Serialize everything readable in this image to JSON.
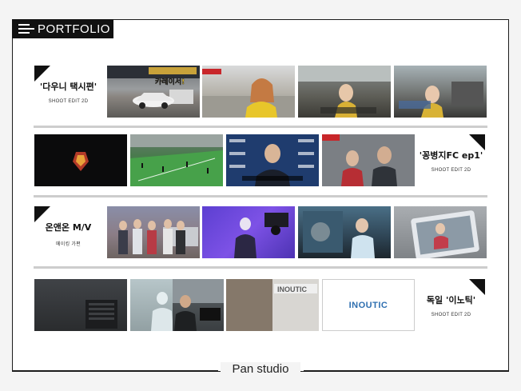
{
  "header": {
    "title": "PORTFOLIO"
  },
  "rows": [
    {
      "title": "'다우니 택시편'",
      "subtitle": "SHOOT EDIT 2D"
    },
    {
      "title": "'꽁병지FC ep1'",
      "subtitle": "SHOOT EDIT 2D"
    },
    {
      "title": "온앤온 M/V",
      "subtitle": "메이킹 가편"
    },
    {
      "title": "독일 '이노틱'",
      "subtitle": "SHOOT EDIT 2D"
    }
  ],
  "thumbnails": {
    "t1_caption": "카레이서!",
    "t9_logo": "INOUTIC",
    "t15_text": "INOUTIC"
  },
  "footer": {
    "brand": "Pan studio"
  },
  "colors": {
    "frame": "#1b1b1b",
    "tab": "#111111",
    "divider": "#cdcdcd",
    "inoutic_blue": "#2e6fb0"
  }
}
